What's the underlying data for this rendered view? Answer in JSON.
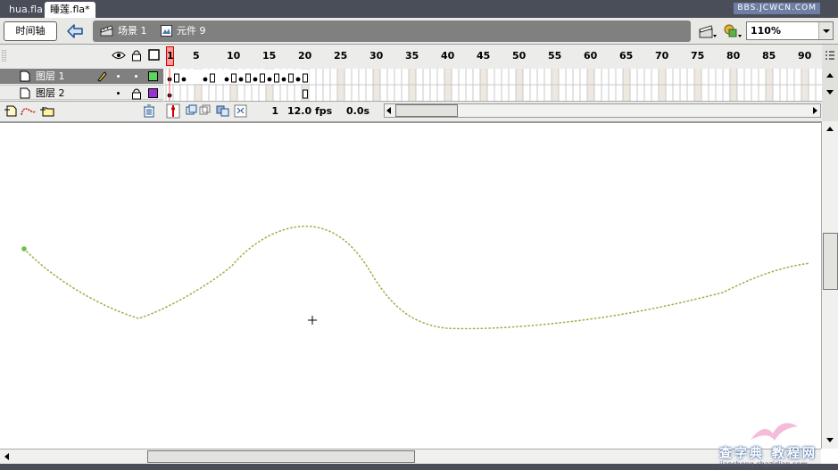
{
  "tabs": [
    {
      "label": "hua.fla",
      "active": false
    },
    {
      "label": "睡莲.fla*",
      "active": true
    }
  ],
  "watermark_top": "BBS.JCWCN.COM",
  "editbar": {
    "timeline_button": "时间轴",
    "breadcrumb": [
      "场景 1",
      "元件 9"
    ],
    "zoom": "110%"
  },
  "timeline": {
    "ruler_labels": [
      "1",
      "5",
      "10",
      "15",
      "20",
      "25",
      "30",
      "35",
      "40",
      "45",
      "50",
      "55",
      "60",
      "65",
      "70",
      "75",
      "80",
      "85",
      "90"
    ],
    "layers": [
      {
        "name": "图层 1",
        "selected": true,
        "outline_color": "#5cd65c"
      },
      {
        "name": "图层 2",
        "selected": false,
        "outline_color": "#9933cc"
      }
    ],
    "current_frame": "1",
    "frame_rate": "12.0 fps",
    "elapsed_time": "0.0s"
  },
  "watermark_bottom": {
    "text": "查字典 教程网",
    "url": "jiaocheng.chazidian.com"
  },
  "colors": {
    "ui_bg": "#ececea",
    "selected_layer": "#808080",
    "playhead": "#ff6666",
    "path_dots": "#9ab54a"
  }
}
